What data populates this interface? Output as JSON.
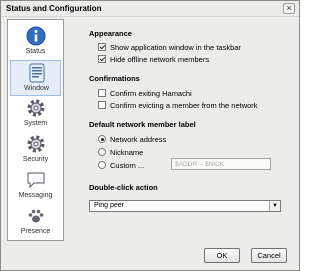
{
  "window": {
    "title": "Status and Configuration"
  },
  "sidebar": {
    "items": [
      {
        "label": "Status",
        "icon": "info-icon",
        "selected": false
      },
      {
        "label": "Window",
        "icon": "window-icon",
        "selected": true
      },
      {
        "label": "System",
        "icon": "gear-icon",
        "selected": false
      },
      {
        "label": "Security",
        "icon": "security-gear-icon",
        "selected": false
      },
      {
        "label": "Messaging",
        "icon": "speech-bubble-icon",
        "selected": false
      },
      {
        "label": "Presence",
        "icon": "paw-icon",
        "selected": false
      }
    ]
  },
  "appearance": {
    "title": "Appearance",
    "show_window": {
      "label": "Show application window in the taskbar",
      "checked": true
    },
    "hide_offline": {
      "label": "Hide offline network members",
      "checked": true
    }
  },
  "confirmations": {
    "title": "Confirmations",
    "confirm_exit": {
      "label": "Confirm exiting Hamachi",
      "checked": false
    },
    "confirm_evict": {
      "label": "Confirm evicting a member from the network",
      "checked": false
    }
  },
  "member_label": {
    "title": "Default network member label",
    "options": [
      {
        "label": "Network address",
        "selected": true
      },
      {
        "label": "Nickname",
        "selected": false
      },
      {
        "label": "Custom ...",
        "selected": false
      }
    ],
    "custom_value": "$ADDR -- $NICK"
  },
  "double_click": {
    "title": "Double-click action",
    "selected": "Ping peer"
  },
  "buttons": {
    "ok": "OK",
    "cancel": "Cancel"
  }
}
